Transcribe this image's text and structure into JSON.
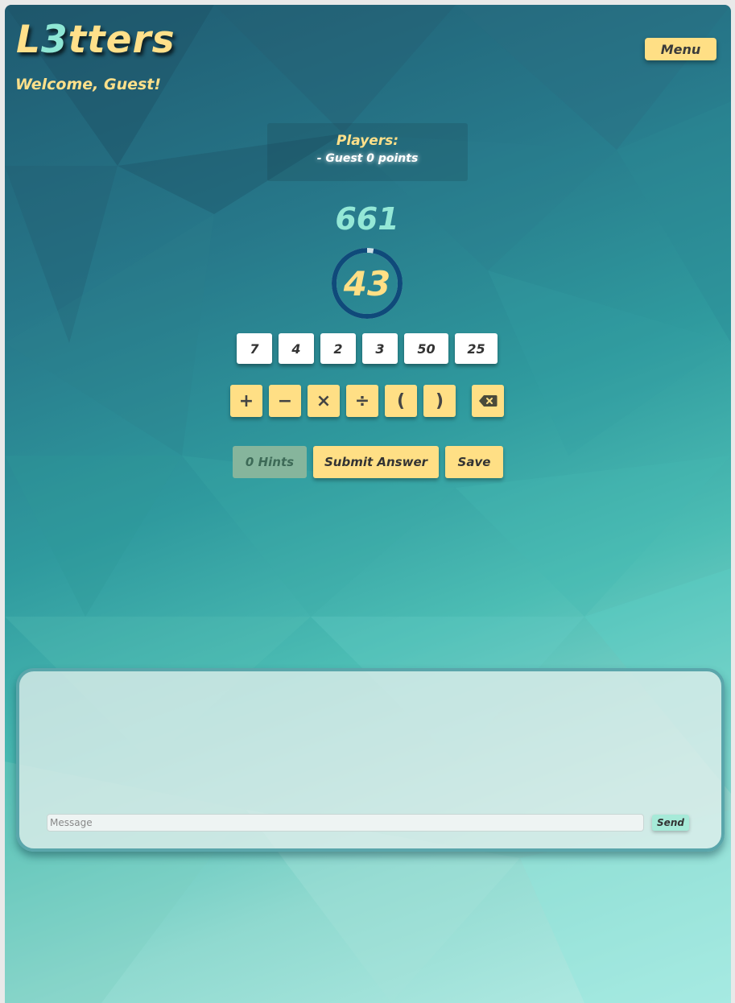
{
  "app": {
    "logo_prefix": "L",
    "logo_accent": "3",
    "logo_suffix": "tters",
    "welcome": "Welcome, Guest!",
    "menu_label": "Menu"
  },
  "players": {
    "title": "Players:",
    "entries": [
      "- Guest 0 points"
    ]
  },
  "game": {
    "target": "661",
    "timer": "43",
    "timer_progress": 0.97,
    "tiles": [
      "7",
      "4",
      "2",
      "3",
      "50",
      "25"
    ],
    "operators": [
      {
        "label": "+",
        "icon": "plus-icon"
      },
      {
        "label": "−",
        "icon": "minus-icon"
      },
      {
        "label": "×",
        "icon": "multiply-icon"
      },
      {
        "label": "÷",
        "icon": "divide-icon"
      },
      {
        "label": "(",
        "icon": "open-paren-icon"
      },
      {
        "label": ")",
        "icon": "close-paren-icon"
      }
    ],
    "backspace_icon": "backspace-icon",
    "hints_label": "0 Hints",
    "submit_label": "Submit Answer",
    "save_label": "Save"
  },
  "chat": {
    "placeholder": "Message",
    "send_label": "Send"
  },
  "colors": {
    "accent_yellow": "#ffdf85",
    "accent_mint": "#94e8d6",
    "timer_ring": "#0f4a7a"
  }
}
